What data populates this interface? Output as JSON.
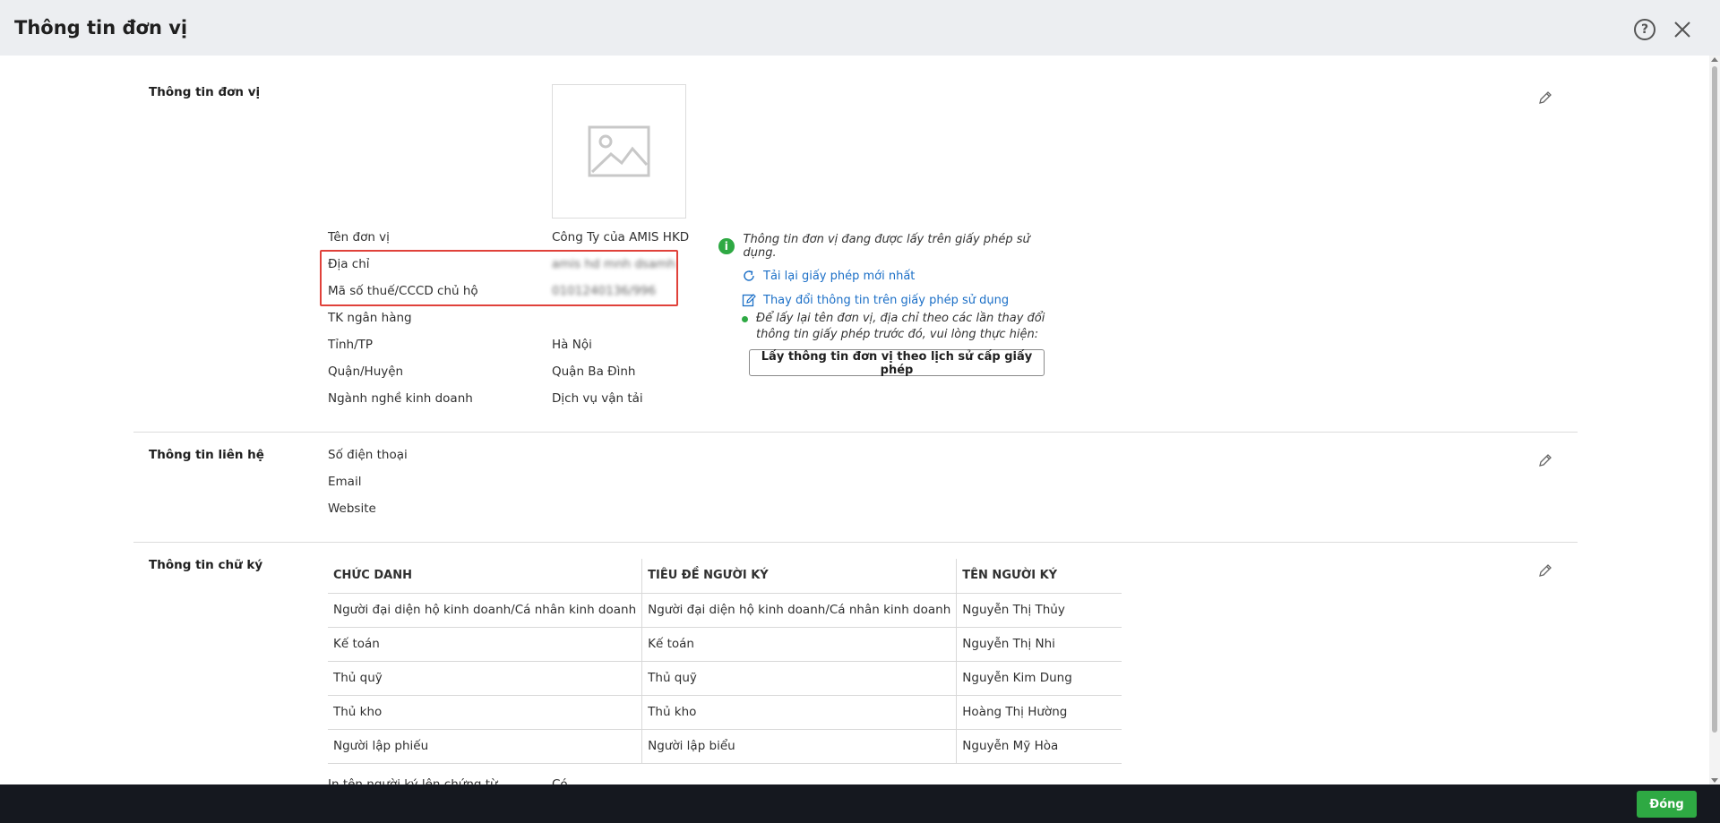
{
  "header": {
    "title": "Thông tin đơn vị",
    "help_glyph": "?"
  },
  "sections": {
    "unit": {
      "title": "Thông tin đơn vị",
      "fields": [
        {
          "label": "Tên đơn vị",
          "value": "Công Ty của AMIS HKD"
        },
        {
          "label": "Địa chỉ",
          "value": "amis hd mnh dsamh"
        },
        {
          "label": "Mã số thuế/CCCD chủ hộ",
          "value": "0101240136/996"
        },
        {
          "label": "TK ngân hàng",
          "value": ""
        },
        {
          "label": "Tỉnh/TP",
          "value": "Hà Nội"
        },
        {
          "label": "Quận/Huyện",
          "value": "Quận Ba Đình"
        },
        {
          "label": "Ngành nghề kinh doanh",
          "value": "Dịch vụ vận tải"
        }
      ]
    },
    "license": {
      "info_text": "Thông tin đơn vị đang được lấy trên giấy phép sử dụng.",
      "reload_link": "Tải lại giấy phép mới nhất",
      "change_link": "Thay đổi thông tin trên giấy phép sử dụng",
      "note": "Để lấy lại tên đơn vị, địa chỉ theo các lần thay đổi thông tin giấy phép trước đó, vui lòng thực hiện:",
      "history_button": "Lấy thông tin đơn vị theo lịch sử cấp giấy phép"
    },
    "contact": {
      "title": "Thông tin liên hệ",
      "fields": [
        {
          "label": "Số điện thoại"
        },
        {
          "label": "Email"
        },
        {
          "label": "Website"
        }
      ]
    },
    "signature": {
      "title": "Thông tin chữ ký",
      "columns": [
        "CHỨC DANH",
        "TIÊU ĐỀ NGƯỜI KÝ",
        "TÊN NGƯỜI KÝ"
      ],
      "rows": [
        [
          "Người đại diện hộ kinh doanh/Cá nhân kinh doanh",
          "Người đại diện hộ kinh doanh/Cá nhân kinh doanh",
          "Nguyễn Thị Thủy"
        ],
        [
          "Kế toán",
          "Kế toán",
          "Nguyễn Thị Nhi"
        ],
        [
          "Thủ quỹ",
          "Thủ quỹ",
          "Nguyễn Kim Dung"
        ],
        [
          "Thủ kho",
          "Thủ kho",
          "Hoàng Thị Hường"
        ],
        [
          "Người lập phiếu",
          "Người lập biểu",
          "Nguyễn Mỹ Hòa"
        ]
      ],
      "partial_label": "In tên người ký lên chứng từ",
      "partial_value": "Có"
    }
  },
  "footer": {
    "close_label": "Đóng"
  },
  "colors": {
    "accent": "#2ea943",
    "link": "#1b6fc7",
    "highlight": "#e0413a",
    "footer_bg": "#15181f"
  }
}
